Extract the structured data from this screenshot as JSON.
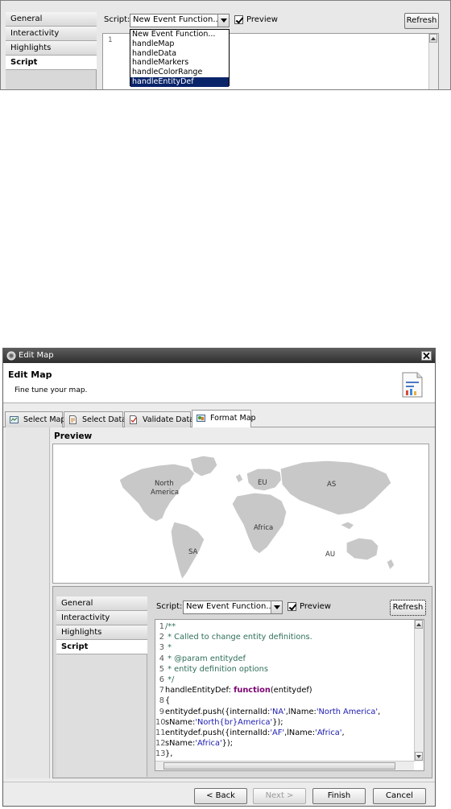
{
  "top_crop": {
    "nav_items": [
      "General",
      "Interactivity",
      "Highlights",
      "Script"
    ],
    "script_label": "Script:",
    "script_value": "New Event Function...",
    "preview_label": "Preview",
    "refresh_label": "Refresh",
    "editor_line_number": "1",
    "dropdown_options": [
      "New Event Function...",
      "handleMap",
      "handleData",
      "handleMarkers",
      "handleColorRange",
      "handleEntityDef"
    ],
    "dropdown_selected_index": 5
  },
  "dialog": {
    "window_title": "Edit Map",
    "header_title": "Edit Map",
    "header_subtitle": "Fine tune your map.",
    "tabs": [
      {
        "label": "Select Map",
        "icon": "select-map-icon"
      },
      {
        "label": "Select Data",
        "icon": "select-data-icon"
      },
      {
        "label": "Validate Data",
        "icon": "validate-data-icon"
      },
      {
        "label": "Format Map",
        "icon": "format-map-icon",
        "active": true
      }
    ],
    "preview_title": "Preview",
    "map_labels": {
      "na": "North\nAmerica",
      "eu": "EU",
      "as": "AS",
      "africa": "Africa",
      "sa": "SA",
      "au": "AU"
    },
    "nav_items": [
      "General",
      "Interactivity",
      "Highlights",
      "Script"
    ],
    "active_nav": "Script",
    "script_label": "Script:",
    "script_value": "New Event Function...",
    "preview_label": "Preview",
    "preview_checked": true,
    "refresh_label": "Refresh",
    "code_lines": [
      {
        "n": "1",
        "parts": [
          {
            "t": "/**",
            "c": "comment"
          }
        ]
      },
      {
        "n": "2",
        "parts": [
          {
            "t": " * Called to change entity definitions.",
            "c": "comment"
          }
        ]
      },
      {
        "n": "3",
        "parts": [
          {
            "t": " *",
            "c": "comment"
          }
        ]
      },
      {
        "n": "4",
        "parts": [
          {
            "t": " * @param entitydef",
            "c": "comment"
          }
        ]
      },
      {
        "n": "5",
        "parts": [
          {
            "t": " *            entity definition options",
            "c": "comment"
          }
        ]
      },
      {
        "n": "6",
        "parts": [
          {
            "t": " */",
            "c": "comment"
          }
        ]
      },
      {
        "n": "7",
        "parts": [
          {
            "t": "handleEntityDef: ",
            "c": ""
          },
          {
            "t": "function",
            "c": "kw"
          },
          {
            "t": "(entitydef)",
            "c": ""
          }
        ]
      },
      {
        "n": "8",
        "parts": [
          {
            "t": "{",
            "c": ""
          }
        ]
      },
      {
        "n": "9",
        "parts": [
          {
            "t": "entitydef.push({internalId:",
            "c": ""
          },
          {
            "t": "'NA'",
            "c": "str"
          },
          {
            "t": ",lName:",
            "c": ""
          },
          {
            "t": "'North America'",
            "c": "str"
          },
          {
            "t": ",",
            "c": ""
          }
        ]
      },
      {
        "n": "10",
        "parts": [
          {
            "t": "sName:",
            "c": ""
          },
          {
            "t": "'North{br}America'",
            "c": "str"
          },
          {
            "t": "});",
            "c": ""
          }
        ]
      },
      {
        "n": "11",
        "parts": [
          {
            "t": "entitydef.push({internalId:",
            "c": ""
          },
          {
            "t": "'AF'",
            "c": "str"
          },
          {
            "t": ",lName:",
            "c": ""
          },
          {
            "t": "'Africa'",
            "c": "str"
          },
          {
            "t": ",",
            "c": ""
          }
        ]
      },
      {
        "n": "12",
        "parts": [
          {
            "t": "sName:",
            "c": ""
          },
          {
            "t": "'Africa'",
            "c": "str"
          },
          {
            "t": "});",
            "c": ""
          }
        ]
      },
      {
        "n": "13",
        "parts": [
          {
            "t": "},",
            "c": ""
          }
        ]
      }
    ],
    "buttons": {
      "back": "< Back",
      "next": "Next >",
      "finish": "Finish",
      "cancel": "Cancel"
    }
  }
}
